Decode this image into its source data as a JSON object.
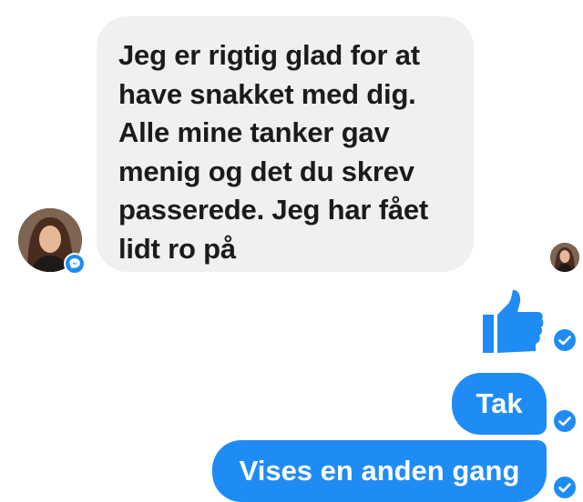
{
  "conversation": {
    "incoming_message": {
      "lines": [
        "Jeg er rigtig glad for at",
        "have snakket med dig.",
        "Alle mine tanker gav",
        "menig og det du skrev",
        "passerede. Jeg har fået",
        "lidt ro på"
      ],
      "sender_avatar_icon": "avatar",
      "platform_badge_icon": "messenger-icon"
    },
    "outgoing_messages": [
      {
        "type": "sticker",
        "icon": "thumbs-up-icon"
      },
      {
        "type": "text",
        "text": "Tak"
      },
      {
        "type": "text",
        "text": "Vises en anden gang"
      }
    ]
  },
  "colors": {
    "outgoing_bubble": "#1f8cf5",
    "incoming_bubble": "#f0f0f0",
    "incoming_text": "#1b1b1b",
    "outgoing_text": "#ffffff"
  }
}
